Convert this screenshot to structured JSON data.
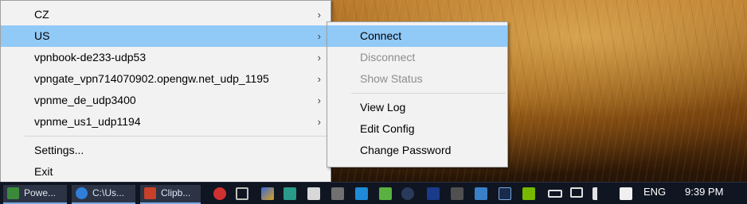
{
  "main_menu": {
    "items": [
      {
        "label": "CZ",
        "has_submenu": true
      },
      {
        "label": "US",
        "has_submenu": true,
        "highlighted": true
      },
      {
        "label": "vpnbook-de233-udp53",
        "has_submenu": true
      },
      {
        "label": "vpngate_vpn714070902.opengw.net_udp_1195",
        "has_submenu": true
      },
      {
        "label": "vpnme_de_udp3400",
        "has_submenu": true
      },
      {
        "label": "vpnme_us1_udp1194",
        "has_submenu": true
      }
    ],
    "settings_label": "Settings...",
    "exit_label": "Exit",
    "arrow_glyph": "›"
  },
  "submenu": {
    "connect_label": "Connect",
    "disconnect_label": "Disconnect",
    "show_status_label": "Show Status",
    "view_log_label": "View Log",
    "edit_config_label": "Edit Config",
    "change_password_label": "Change Password"
  },
  "taskbar": {
    "buttons": [
      {
        "label": "Powe...",
        "icon": "powershell-icon",
        "color": "#3a8a3a"
      },
      {
        "label": "C:\\Us...",
        "icon": "ie-icon",
        "color": "#2f7fd8"
      },
      {
        "label": "Clipb...",
        "icon": "clipboard-icon",
        "color": "#c8402a"
      }
    ],
    "language": "ENG",
    "time": "9:39 PM"
  },
  "colors": {
    "highlight": "#91c9f7",
    "menu_bg": "#f2f2f2",
    "disabled_text": "#8d8d8d",
    "taskbar_bg": "#101522"
  }
}
